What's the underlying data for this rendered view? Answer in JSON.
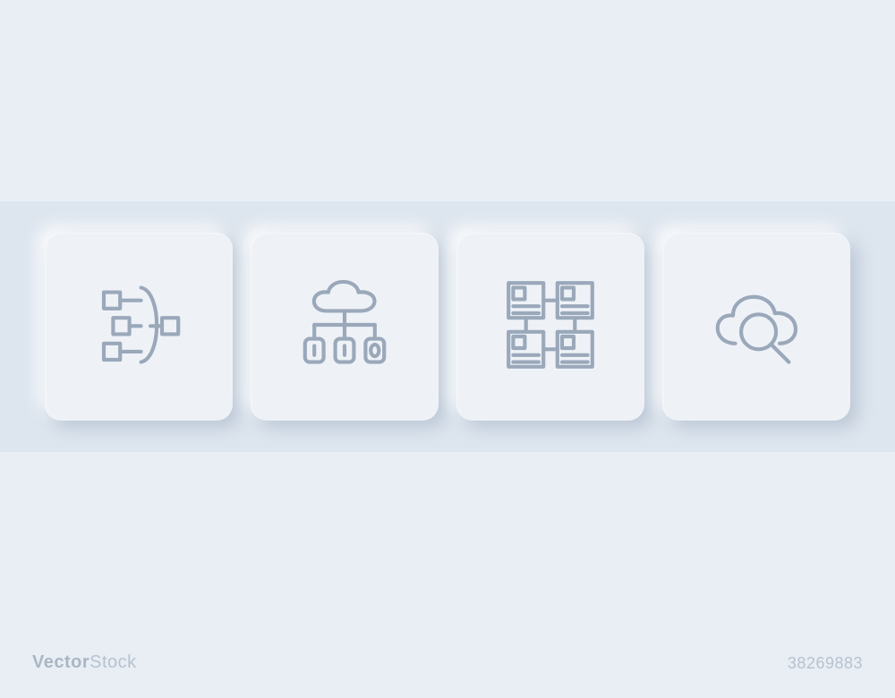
{
  "icons": [
    {
      "name": "filter-data-icon"
    },
    {
      "name": "cloud-network-icon"
    },
    {
      "name": "blockchain-grid-icon"
    },
    {
      "name": "cloud-search-icon"
    }
  ],
  "watermark": {
    "brand_bold": "Vector",
    "brand_light": "Stock",
    "image_id": "38269883"
  }
}
